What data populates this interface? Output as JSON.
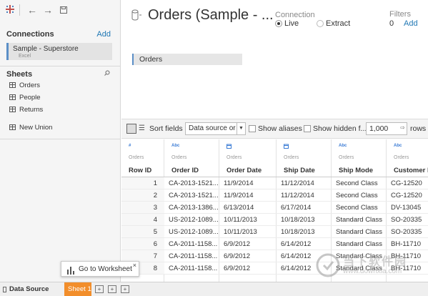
{
  "connections": {
    "title": "Connections",
    "add_label": "Add",
    "items": [
      {
        "name": "Sample - Superstore",
        "type": "Excel"
      }
    ]
  },
  "sheets": {
    "title": "Sheets",
    "items": [
      "Orders",
      "People",
      "Returns"
    ],
    "new_union": "New Union"
  },
  "datasource": {
    "title": "Orders (Sample - ...",
    "connection_label": "Connection",
    "connection_options": [
      "Live",
      "Extract"
    ],
    "connection_selected": "Live",
    "filters_label": "Filters",
    "filters_count": "0",
    "filters_add": "Add",
    "canvas_table": "Orders"
  },
  "grid_toolbar": {
    "sort_label": "Sort fields",
    "sort_value": "Data source or",
    "show_aliases": "Show aliases",
    "show_hidden": "Show hidden f...",
    "rows_value": "1,000",
    "rows_label": "rows"
  },
  "table": {
    "type_labels": [
      "#",
      "Abc",
      "",
      "",
      "Abc",
      "Abc"
    ],
    "source_label": "Orders",
    "columns": [
      "Row ID",
      "Order ID",
      "Order Date",
      "Ship Date",
      "Ship Mode",
      "Customer ID"
    ],
    "rows": [
      [
        "1",
        "CA-2013-1521...",
        "11/9/2014",
        "11/12/2014",
        "Second Class",
        "CG-12520"
      ],
      [
        "2",
        "CA-2013-1521...",
        "11/9/2014",
        "11/12/2014",
        "Second Class",
        "CG-12520"
      ],
      [
        "3",
        "CA-2013-1386...",
        "6/13/2014",
        "6/17/2014",
        "Second Class",
        "DV-13045"
      ],
      [
        "4",
        "US-2012-1089...",
        "10/11/2013",
        "10/18/2013",
        "Standard Class",
        "SO-20335"
      ],
      [
        "5",
        "US-2012-1089...",
        "10/11/2013",
        "10/18/2013",
        "Standard Class",
        "SO-20335"
      ],
      [
        "6",
        "CA-2011-1158...",
        "6/9/2012",
        "6/14/2012",
        "Standard Class",
        "BH-11710"
      ],
      [
        "7",
        "CA-2011-1158...",
        "6/9/2012",
        "6/14/2012",
        "Standard Class",
        "BH-11710"
      ],
      [
        "8",
        "CA-2011-1158...",
        "6/9/2012",
        "6/14/2012",
        "Standard Class",
        "BH-11710"
      ]
    ]
  },
  "tooltip": {
    "label": "Go to Worksheet",
    "close": "×"
  },
  "tabs": {
    "data_source": "Data Source",
    "sheet1": "Sheet 1"
  },
  "watermark": {
    "line1": "当下软件园",
    "line2": "www.downxia.com"
  },
  "colors": {
    "accent": "#1f77b4",
    "active_tab": "#f28e2b",
    "selection_bar": "#5b8fc7"
  }
}
